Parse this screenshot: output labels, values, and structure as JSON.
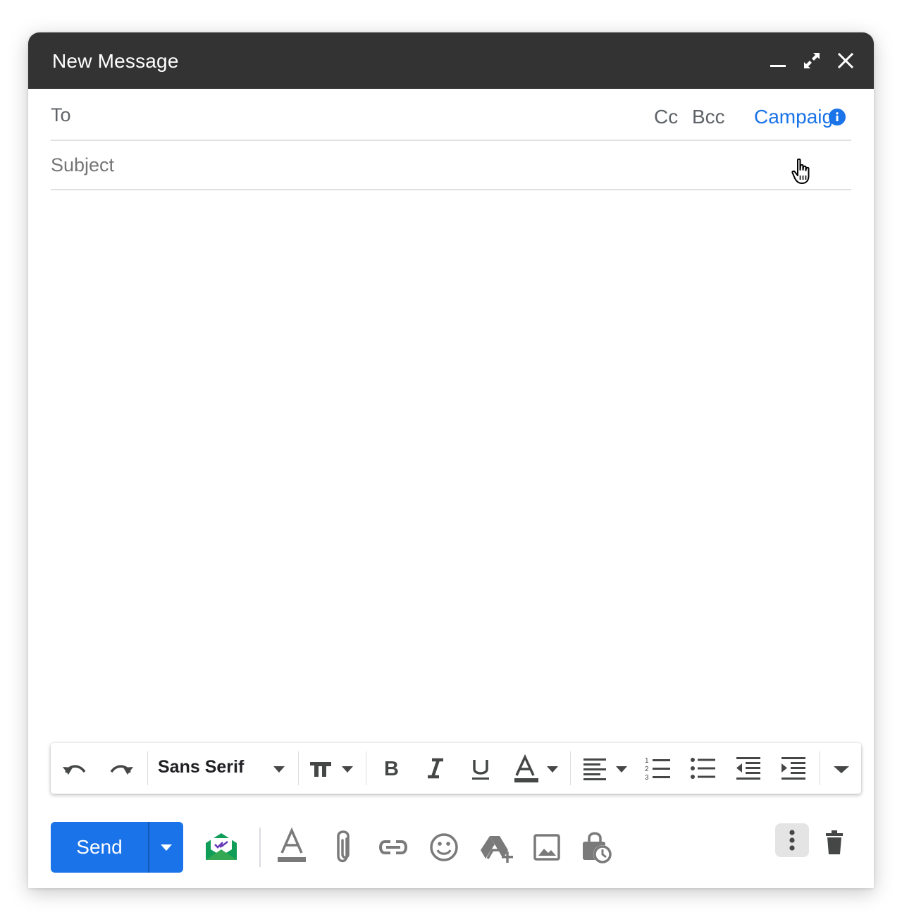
{
  "window": {
    "title": "New Message"
  },
  "titlebar_icons": [
    "minimize-icon",
    "expand-icon",
    "close-icon"
  ],
  "recipients": {
    "to_label": "To",
    "to_value": "",
    "cc_label": "Cc",
    "bcc_label": "Bcc",
    "campaign_label": "Campaign"
  },
  "subject": {
    "placeholder": "Subject",
    "value": ""
  },
  "body": {
    "value": ""
  },
  "formatting": {
    "font_family": "Sans Serif",
    "icons": [
      "undo-icon",
      "redo-icon",
      "text-size-icon",
      "bold-icon",
      "italic-icon",
      "underline-icon",
      "text-color-icon",
      "align-icon",
      "numbered-list-icon",
      "bulleted-list-icon",
      "indent-less-icon",
      "indent-more-icon",
      "more-formatting-icon"
    ]
  },
  "actions": {
    "send_label": "Send",
    "icons": [
      "schedule-send-dropdown-icon",
      "mail-tracking-icon",
      "formatting-options-icon",
      "attach-icon",
      "link-icon",
      "emoji-icon",
      "drive-icon",
      "photo-icon",
      "confidential-mode-icon",
      "more-options-icon",
      "discard-icon"
    ]
  },
  "colors": {
    "titlebar": "#333333",
    "accent": "#1a73e8",
    "icon_gray": "#5f6368",
    "tracking_green": "#0f9d58",
    "tracking_purple": "#673ab7"
  }
}
